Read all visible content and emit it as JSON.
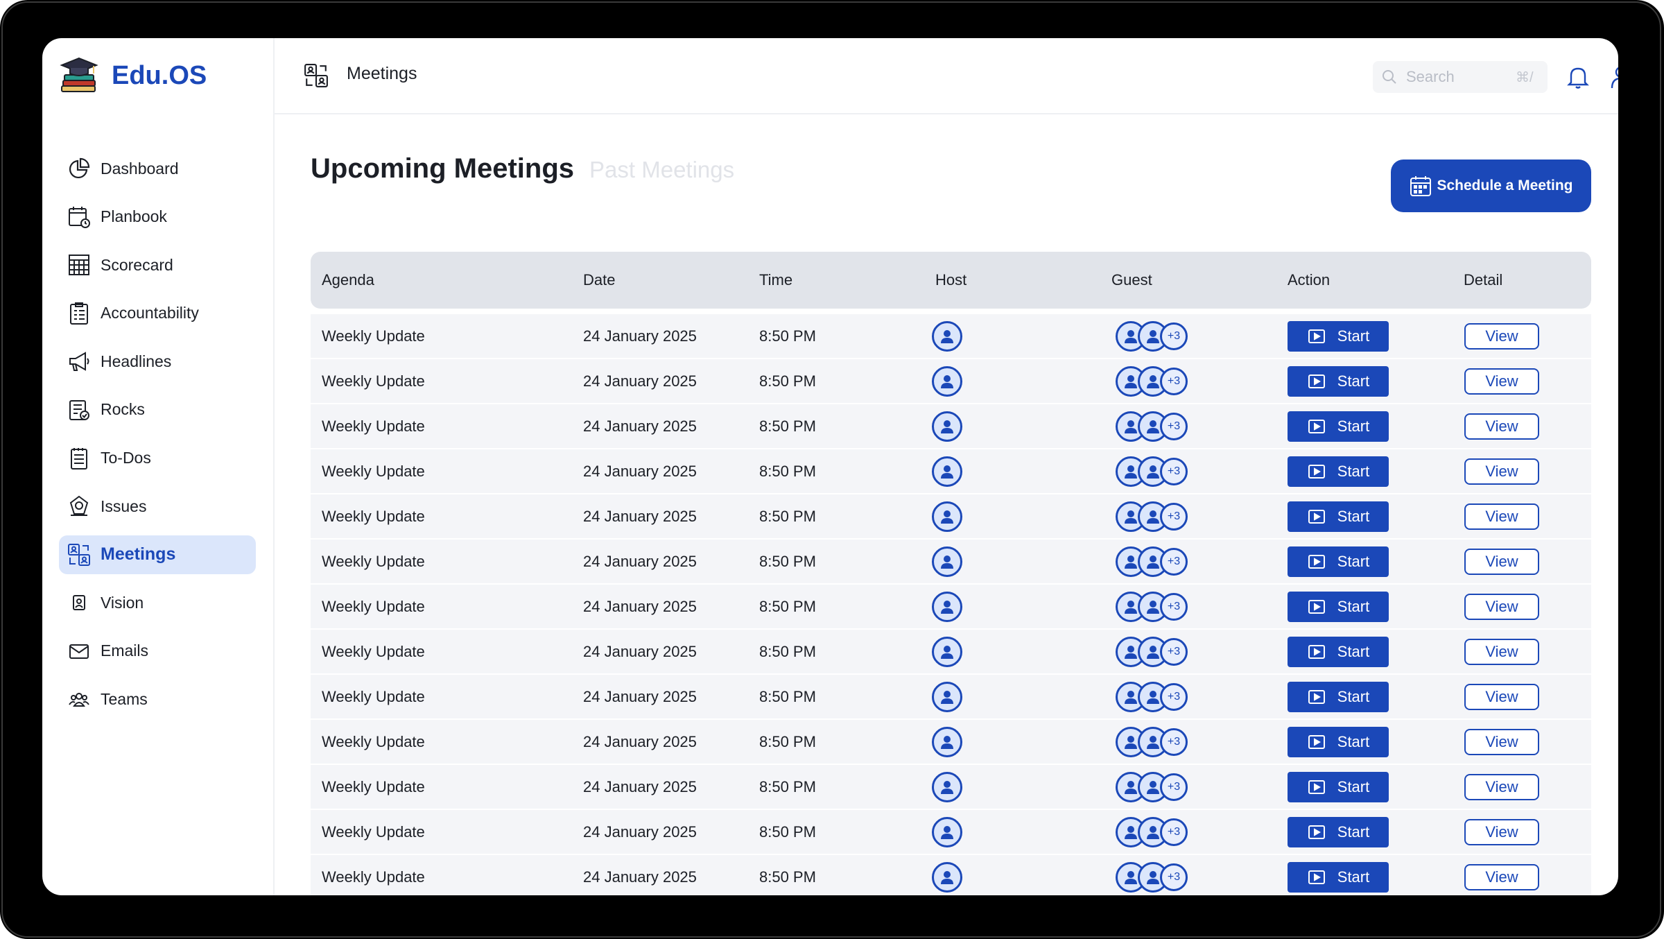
{
  "app": {
    "name": "Edu.OS"
  },
  "sidebar": {
    "items": [
      {
        "label": "Dashboard",
        "icon": "pie-chart-icon"
      },
      {
        "label": "Planbook",
        "icon": "calendar-clock-icon"
      },
      {
        "label": "Scorecard",
        "icon": "scorecard-grid-icon"
      },
      {
        "label": "Accountability",
        "icon": "checklist-icon"
      },
      {
        "label": "Headlines",
        "icon": "megaphone-icon"
      },
      {
        "label": "Rocks",
        "icon": "rocks-report-icon"
      },
      {
        "label": "To-Dos",
        "icon": "todo-list-icon"
      },
      {
        "label": "Issues",
        "icon": "issues-icon"
      },
      {
        "label": "Meetings",
        "icon": "meetings-icon",
        "active": true
      },
      {
        "label": "Vision",
        "icon": "vision-icon"
      },
      {
        "label": "Emails",
        "icon": "mail-icon"
      },
      {
        "label": "Teams",
        "icon": "team-icon"
      }
    ]
  },
  "header": {
    "title": "Meetings",
    "search": {
      "placeholder": "Search",
      "shortcut": "⌘/"
    }
  },
  "main": {
    "tabs": {
      "active": "Upcoming Meetings",
      "inactive": "Past Meetings"
    },
    "schedule_button": "Schedule a Meeting",
    "table": {
      "columns": [
        "Agenda",
        "Date",
        "Time",
        "Host",
        "Guest",
        "Action",
        "Detail"
      ],
      "rows": [
        {
          "agenda": "Weekly Update",
          "date": "24 January 2025",
          "time": "8:50 PM",
          "guest_more": "+3",
          "action": "Start",
          "detail": "View"
        },
        {
          "agenda": "Weekly Update",
          "date": "24 January 2025",
          "time": "8:50 PM",
          "guest_more": "+3",
          "action": "Start",
          "detail": "View"
        },
        {
          "agenda": "Weekly Update",
          "date": "24 January 2025",
          "time": "8:50 PM",
          "guest_more": "+3",
          "action": "Start",
          "detail": "View"
        },
        {
          "agenda": "Weekly Update",
          "date": "24 January 2025",
          "time": "8:50 PM",
          "guest_more": "+3",
          "action": "Start",
          "detail": "View"
        },
        {
          "agenda": "Weekly Update",
          "date": "24 January 2025",
          "time": "8:50 PM",
          "guest_more": "+3",
          "action": "Start",
          "detail": "View"
        },
        {
          "agenda": "Weekly Update",
          "date": "24 January 2025",
          "time": "8:50 PM",
          "guest_more": "+3",
          "action": "Start",
          "detail": "View"
        },
        {
          "agenda": "Weekly Update",
          "date": "24 January 2025",
          "time": "8:50 PM",
          "guest_more": "+3",
          "action": "Start",
          "detail": "View"
        },
        {
          "agenda": "Weekly Update",
          "date": "24 January 2025",
          "time": "8:50 PM",
          "guest_more": "+3",
          "action": "Start",
          "detail": "View"
        },
        {
          "agenda": "Weekly Update",
          "date": "24 January 2025",
          "time": "8:50 PM",
          "guest_more": "+3",
          "action": "Start",
          "detail": "View"
        },
        {
          "agenda": "Weekly Update",
          "date": "24 January 2025",
          "time": "8:50 PM",
          "guest_more": "+3",
          "action": "Start",
          "detail": "View"
        },
        {
          "agenda": "Weekly Update",
          "date": "24 January 2025",
          "time": "8:50 PM",
          "guest_more": "+3",
          "action": "Start",
          "detail": "View"
        },
        {
          "agenda": "Weekly Update",
          "date": "24 January 2025",
          "time": "8:50 PM",
          "guest_more": "+3",
          "action": "Start",
          "detail": "View"
        },
        {
          "agenda": "Weekly Update",
          "date": "24 January 2025",
          "time": "8:50 PM",
          "guest_more": "+3",
          "action": "Start",
          "detail": "View"
        }
      ]
    }
  },
  "colors": {
    "brand": "#1b48b8",
    "active_bg": "#dbe6fb",
    "header_row": "#e1e4ea",
    "row_bg": "#f4f5f8",
    "inactive_tab": "#e1e3e8"
  }
}
